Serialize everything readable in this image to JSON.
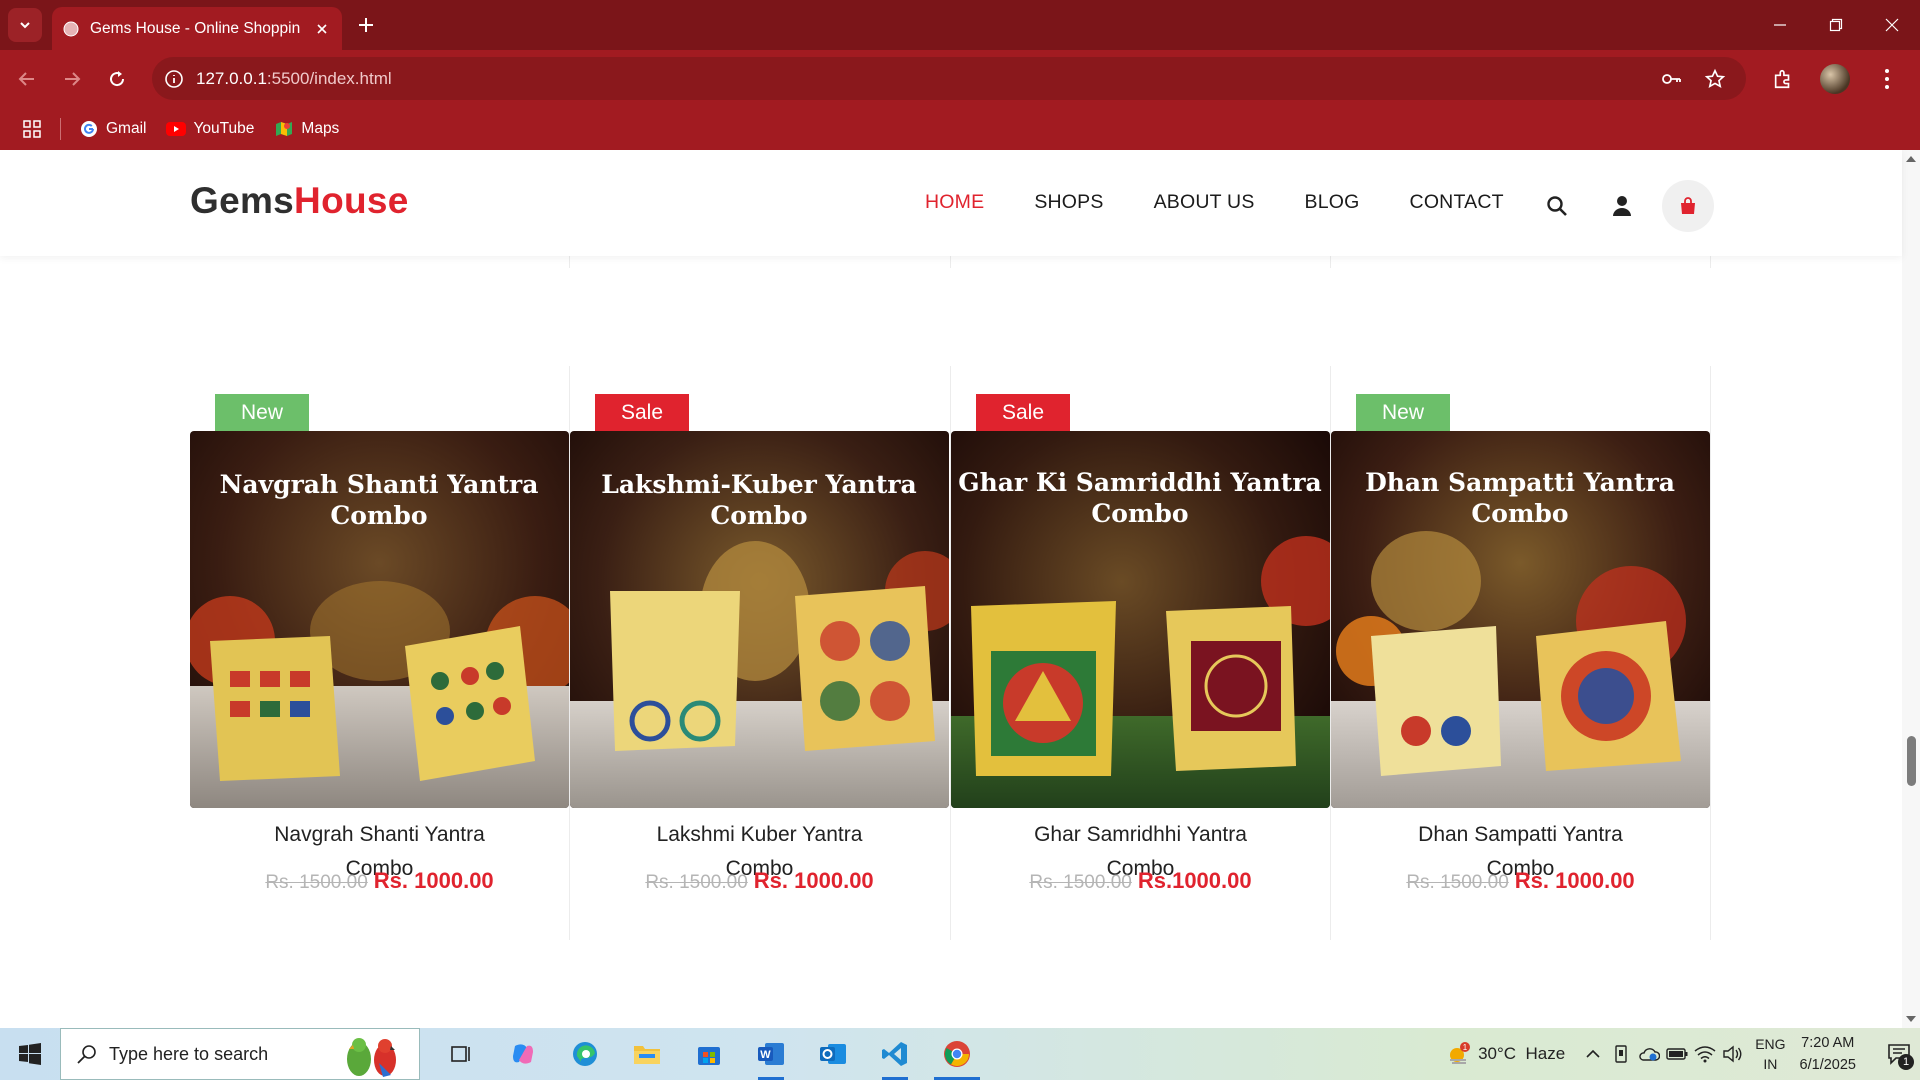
{
  "browser": {
    "tab_title": "Gems House - Online Shopping",
    "url_host": "127.0.0.1",
    "url_rest": ":5500/index.html",
    "bookmarks": [
      {
        "label": "Gmail",
        "icon": "google-icon"
      },
      {
        "label": "YouTube",
        "icon": "youtube-icon"
      },
      {
        "label": "Maps",
        "icon": "maps-icon"
      }
    ]
  },
  "site": {
    "logo_part1": "Gems",
    "logo_part2": "House",
    "nav": [
      "HOME",
      "SHOPS",
      "ABOUT US",
      "BLOG",
      "CONTACT"
    ],
    "active_nav": "HOME",
    "colors": {
      "accent": "#e0232e",
      "new_badge": "#6cbf6a",
      "chrome": "#a21b21"
    }
  },
  "products": [
    {
      "badge": "New",
      "badge_type": "new",
      "image_text": "Navgrah Shanti Yantra Combo",
      "name_line1": "Navgrah Shanti Yantra",
      "name_line2": "Combo",
      "old_price": "Rs. 1500.00",
      "price": "Rs. 1000.00"
    },
    {
      "badge": "Sale",
      "badge_type": "sale",
      "image_text": "Lakshmi-Kuber Yantra Combo",
      "name_line1": "Lakshmi Kuber Yantra",
      "name_line2": "Combo",
      "old_price": "Rs. 1500.00",
      "price": "Rs. 1000.00"
    },
    {
      "badge": "Sale",
      "badge_type": "sale",
      "image_text": "Ghar Ki Samriddhi Yantra Combo",
      "name_line1": "Ghar Samridhhi Yantra",
      "name_line2": "Combo",
      "old_price": "Rs. 1500.00",
      "price": "Rs.1000.00"
    },
    {
      "badge": "New",
      "badge_type": "new",
      "image_text": "Dhan Sampatti Yantra Combo",
      "name_line1": "Dhan Sampatti Yantra",
      "name_line2": "Combo",
      "old_price": "Rs. 1500.00",
      "price": "Rs. 1000.00"
    }
  ],
  "taskbar": {
    "search_placeholder": "Type here to search",
    "weather_temp": "30°C",
    "weather_desc": "Haze",
    "weather_alert": "1",
    "lang_top": "ENG",
    "lang_bottom": "IN",
    "time": "7:20 AM",
    "date": "6/1/2025",
    "notification_count": "1"
  }
}
